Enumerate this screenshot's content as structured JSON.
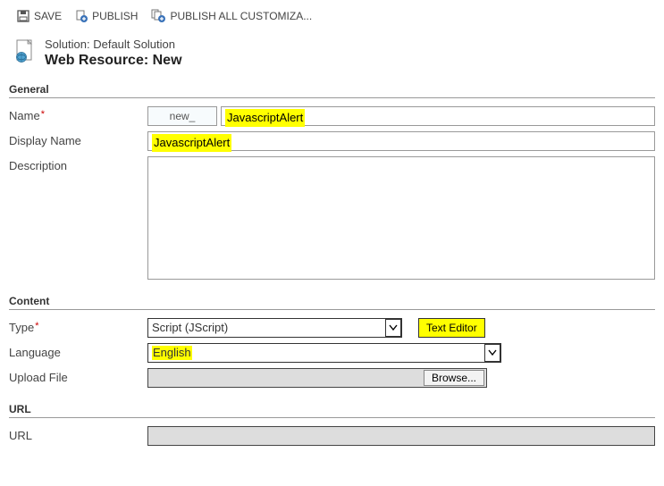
{
  "toolbar": {
    "save_label": "SAVE",
    "publish_label": "PUBLISH",
    "publish_all_label": "PUBLISH ALL CUSTOMIZA..."
  },
  "header": {
    "solution_label": "Solution:",
    "solution_name": "Default Solution",
    "title": "Web Resource: New"
  },
  "sections": {
    "general": "General",
    "content": "Content",
    "url": "URL"
  },
  "general": {
    "name_label": "Name",
    "name_prefix": "new_",
    "name_value": "JavascriptAlert",
    "display_name_label": "Display Name",
    "display_name_value": "JavascriptAlert",
    "description_label": "Description",
    "description_value": ""
  },
  "content": {
    "type_label": "Type",
    "type_value": "Script (JScript)",
    "text_editor_btn": "Text Editor",
    "language_label": "Language",
    "language_value": "English",
    "upload_label": "Upload File",
    "browse_btn": "Browse..."
  },
  "url": {
    "url_label": "URL",
    "url_value": ""
  }
}
